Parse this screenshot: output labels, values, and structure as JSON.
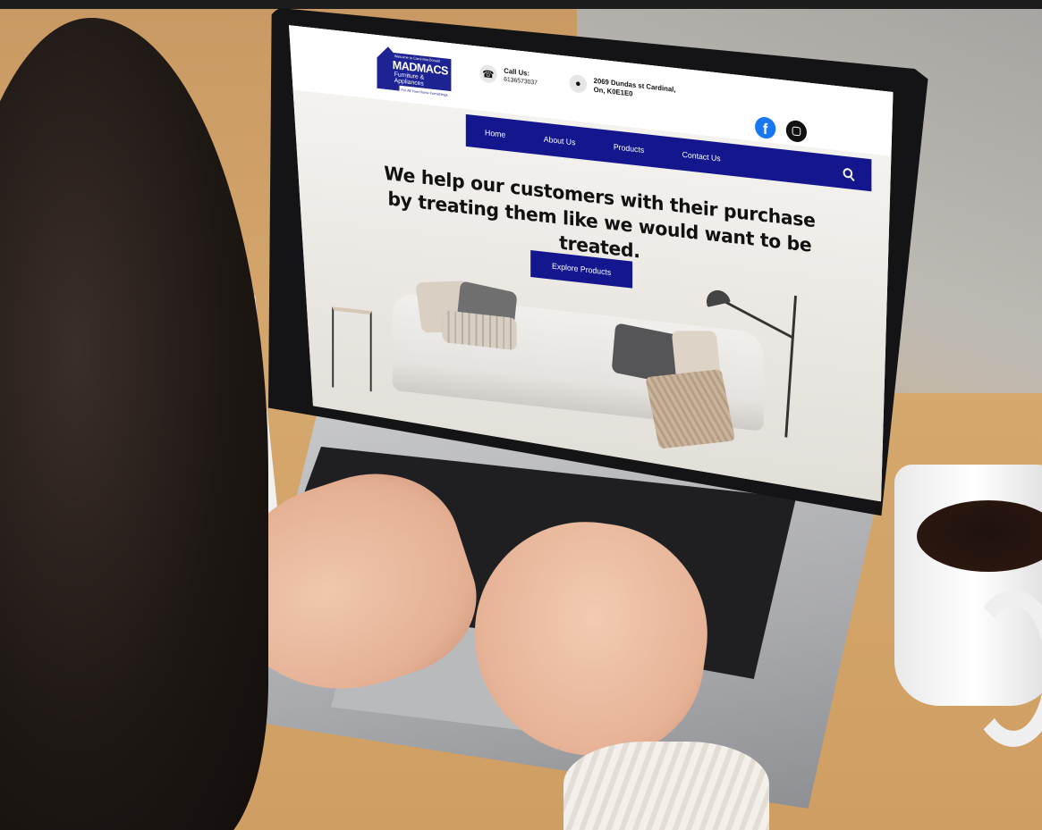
{
  "site": {
    "logo": {
      "tagline": "Welcome to Carol MacDonald",
      "brand": "MADMACS",
      "subtitle": "Furniture & Appliances",
      "slogan": "For All Your Home Furnishings"
    },
    "contact": {
      "call_label": "Call Us:",
      "phone": "6136573037",
      "address_line1": "2069 Dundas st Cardinal,",
      "address_line2": "On, K0E1E0"
    },
    "social": {
      "facebook_icon": "facebook-icon",
      "instagram_icon": "instagram-icon"
    },
    "nav": {
      "items": [
        "Home",
        "About Us",
        "Products",
        "Contact Us"
      ],
      "search_icon": "search-icon"
    },
    "hero": {
      "headline": "We help our customers with their purchase by treating them like we would want to be treated.",
      "cta": "Explore Products"
    }
  },
  "colors": {
    "brand_blue": "#14168d",
    "facebook_blue": "#1877f2"
  }
}
